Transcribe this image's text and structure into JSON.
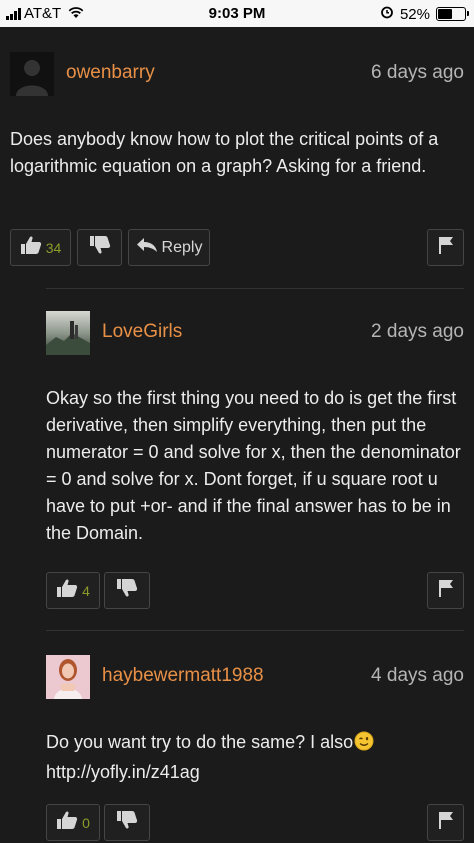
{
  "status_bar": {
    "carrier": "AT&T",
    "time": "9:03 PM",
    "battery_percent": "52%",
    "battery_level": 0.52
  },
  "comments": [
    {
      "user": "owenbarry",
      "time_ago": "6 days ago",
      "text": "Does anybody know how to plot the critical points of a logarithmic equation on a graph? Asking for a friend.",
      "likes": "34",
      "reply_label": "Reply",
      "avatar": "default-user-icon"
    },
    {
      "user": "LoveGirls",
      "time_ago": "2 days ago",
      "text": "Okay so the first thing you need to do is get the first derivative, then simplify everything, then put the numerator = 0 and solve for x, then the denominator = 0 and solve for x. Dont forget, if u square root u have to put +or- and if the final answer has to be in the Domain.",
      "likes": "4",
      "avatar": "photo-avatar"
    },
    {
      "user": "haybewermatt1988",
      "time_ago": "4 days ago",
      "text": "Do you want try to do the same? I also",
      "link": "http://yofly.in/z41ag",
      "emoji": "wink-emoji",
      "likes": "0",
      "avatar": "photo-avatar"
    }
  ],
  "colors": {
    "background": "#1b1b1b",
    "username": "#e89046",
    "like_count": "#8d9b2a",
    "text": "#ececec",
    "muted": "#b5b5b5"
  }
}
